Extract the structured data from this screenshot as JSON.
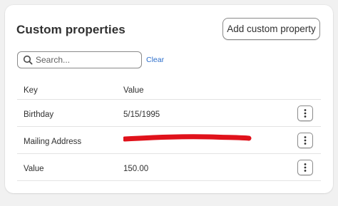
{
  "section": {
    "title": "Custom properties",
    "add_button_label": "Add custom property"
  },
  "search": {
    "placeholder": "Search...",
    "value": "",
    "clear_label": "Clear"
  },
  "table": {
    "headers": {
      "key": "Key",
      "value": "Value"
    },
    "rows": [
      {
        "key": "Birthday",
        "value": "5/15/1995"
      },
      {
        "key": "Mailing Address",
        "value": ""
      },
      {
        "key": "Value",
        "value": "150.00"
      }
    ]
  },
  "colors": {
    "accent_link": "#2c6ecb",
    "redaction_mark": "#e0121b"
  },
  "icons": {
    "search": "search-icon",
    "row_menu": "vertical-ellipsis-icon"
  }
}
